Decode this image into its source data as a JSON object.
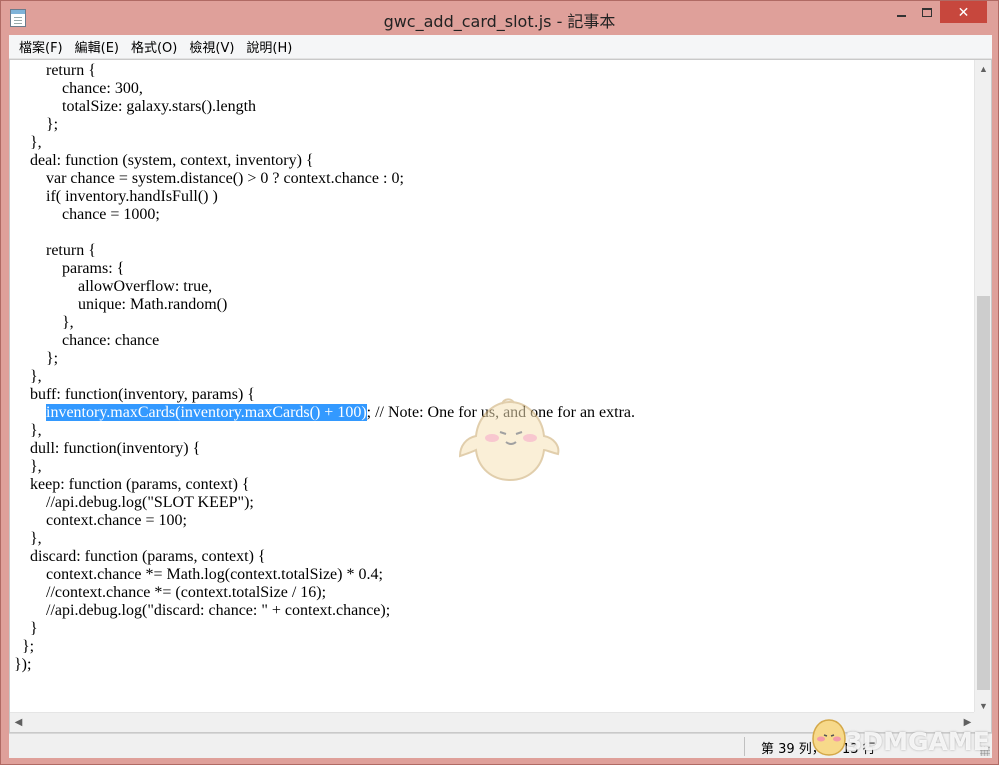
{
  "window": {
    "title": "gwc_add_card_slot.js - 記事本",
    "icon": "notepad-icon"
  },
  "menu": {
    "items": [
      "檔案(F)",
      "編輯(E)",
      "格式(O)",
      "檢視(V)",
      "說明(H)"
    ]
  },
  "editor": {
    "lines": [
      {
        "text": "        return {"
      },
      {
        "text": "            chance: 300,"
      },
      {
        "text": "            totalSize: galaxy.stars().length"
      },
      {
        "text": "        };"
      },
      {
        "text": "    },"
      },
      {
        "text": "    deal: function (system, context, inventory) {"
      },
      {
        "text": "        var chance = system.distance() > 0 ? context.chance : 0;"
      },
      {
        "text": "        if( inventory.handIsFull() )"
      },
      {
        "text": "            chance = 1000;"
      },
      {
        "text": ""
      },
      {
        "text": "        return {"
      },
      {
        "text": "            params: {"
      },
      {
        "text": "                allowOverflow: true,"
      },
      {
        "text": "                unique: Math.random()"
      },
      {
        "text": "            },"
      },
      {
        "text": "            chance: chance"
      },
      {
        "text": "        };"
      },
      {
        "text": "    },"
      },
      {
        "text": "    buff: function(inventory, params) {"
      },
      {
        "indent": "        ",
        "selected": "inventory.maxCards(inventory.maxCards() + 100)",
        "rest": "; // Note: One for us, and one for an extra."
      },
      {
        "text": "    },"
      },
      {
        "text": "    dull: function(inventory) {"
      },
      {
        "text": "    },"
      },
      {
        "text": "    keep: function (params, context) {"
      },
      {
        "text": "        //api.debug.log(\"SLOT KEEP\");"
      },
      {
        "text": "        context.chance = 100;"
      },
      {
        "text": "    },"
      },
      {
        "text": "    discard: function (params, context) {"
      },
      {
        "text": "        context.chance *= Math.log(context.totalSize) * 0.4;"
      },
      {
        "text": "        //context.chance *= (context.totalSize / 16);"
      },
      {
        "text": "        //api.debug.log(\"discard: chance: \" + context.chance);"
      },
      {
        "text": "    }"
      },
      {
        "text": "  };"
      },
      {
        "text": "});"
      }
    ]
  },
  "status": {
    "position": "第 39 列，第 13 行"
  },
  "watermark": {
    "logo_text": "3DMGAME"
  },
  "colors": {
    "titlebar": "#dfa09a",
    "close_button": "#c7473d",
    "selection": "#3399ff"
  }
}
